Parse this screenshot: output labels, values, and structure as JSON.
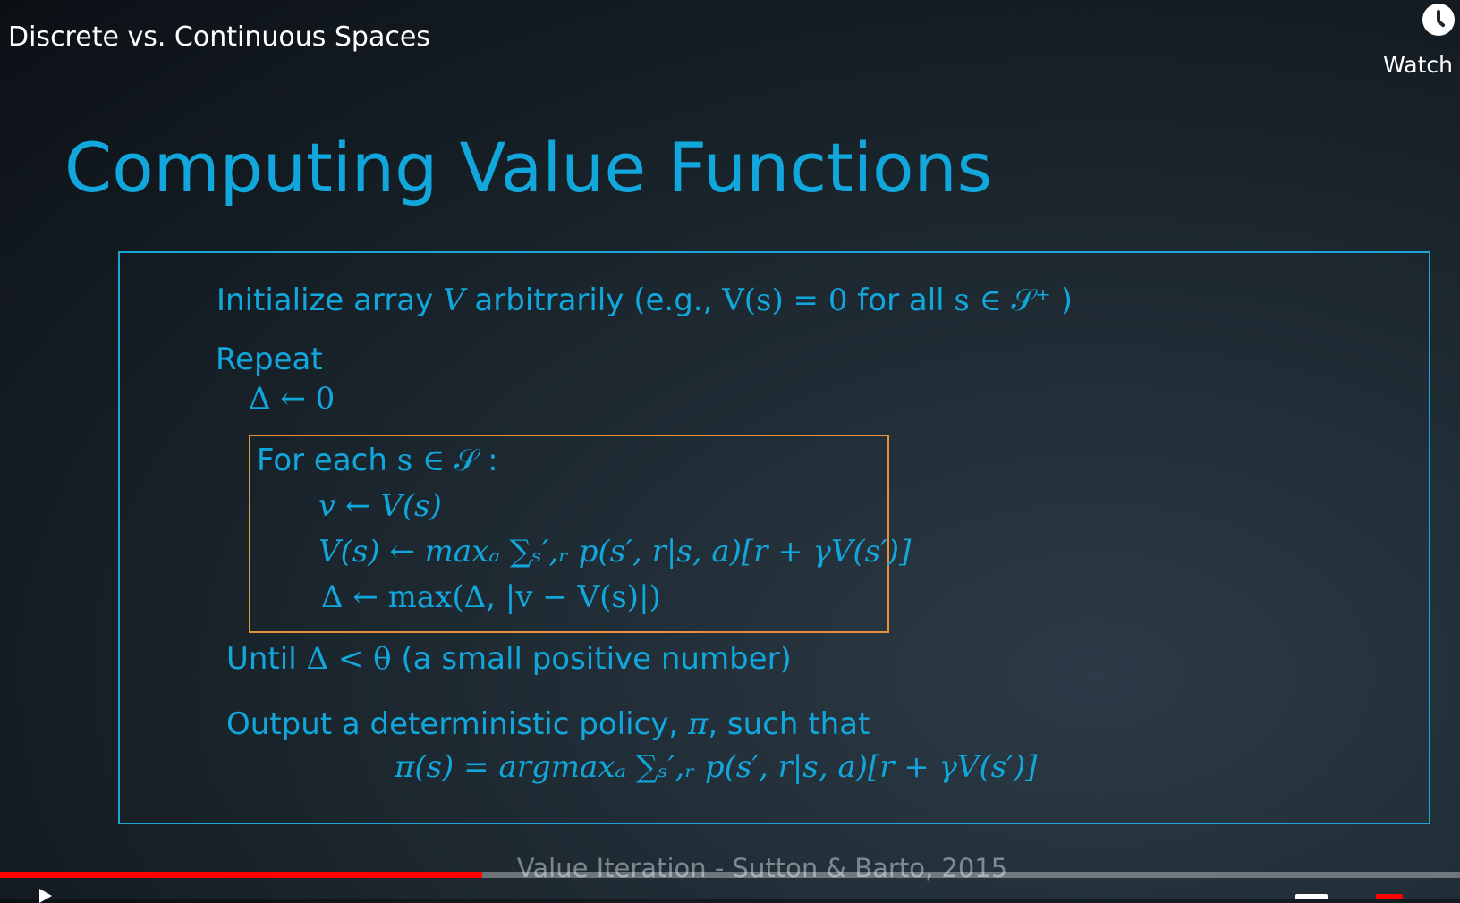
{
  "player": {
    "video_title": "Discrete vs. Continuous Spaces",
    "watch_later_label": "Watch",
    "progress_fraction": 0.33,
    "colors": {
      "progress": "#ff0000",
      "accent": "#12a7dc",
      "inner_box_border": "#e7913a"
    }
  },
  "slide": {
    "title": "Computing Value Functions",
    "caption": "Value Iteration - Sutton & Barto, 2015",
    "lines": {
      "init_text1": "Initialize array ",
      "init_V": "V",
      "init_text2": " arbitrarily (e.g., ",
      "init_math": "V(s) = 0",
      "init_text3": "  for all  ",
      "init_math2": "s ∈ 𝒮⁺",
      "init_text4": " )",
      "repeat": "Repeat",
      "delta_init": "Δ ← 0",
      "for_each_text": "For each ",
      "for_each_math": "s ∈ 𝒮",
      "for_each_colon": " :",
      "v_assign": "v ← V(s)",
      "bellman": "V(s) ← maxₐ ∑ₛ′,ᵣ p(s′, r|s, a)[r + γV(s′)]",
      "delta_update": "Δ ← max(Δ, |v − V(s)|)",
      "until_text1": "Until ",
      "until_math": "Δ < θ",
      "until_text2": " (a small positive number)",
      "output_text1": "Output a deterministic policy, ",
      "output_pi": "π",
      "output_text2": ", such that",
      "policy": "π(s) = argmaxₐ ∑ₛ′,ᵣ p(s′, r|s, a)[r + γV(s′)]"
    }
  },
  "icons": {
    "watch_later": "clock-icon",
    "play": "play-icon",
    "captions": "captions-icon",
    "youtube": "youtube-icon"
  }
}
